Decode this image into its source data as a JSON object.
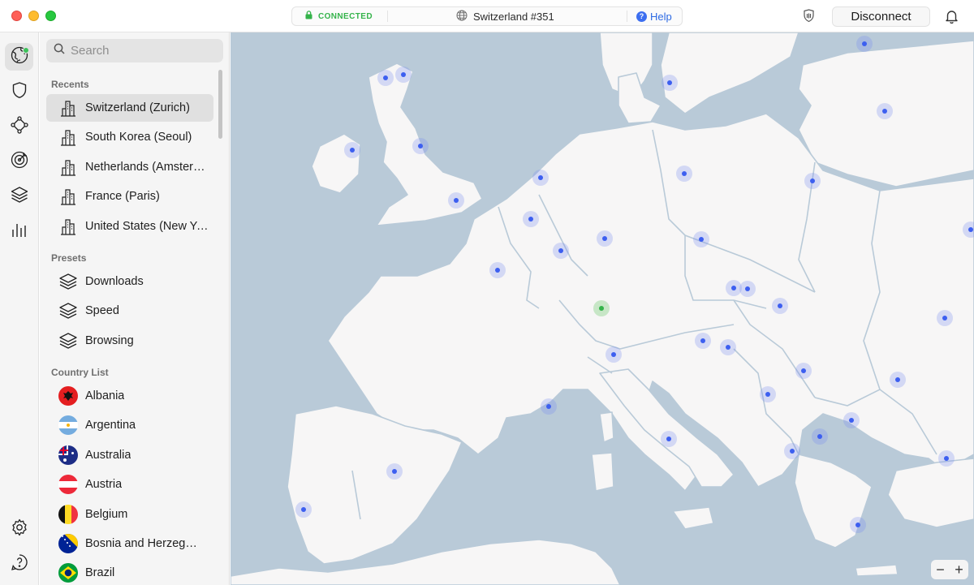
{
  "window": {
    "status_label": "CONNECTED",
    "server_name": "Switzerland #351",
    "help_label": "Help",
    "disconnect_label": "Disconnect"
  },
  "rail": {
    "items": [
      "globe-icon",
      "shield-icon",
      "meshnet-icon",
      "target-icon",
      "layers-icon",
      "stats-icon"
    ],
    "bottom": [
      "gear-icon",
      "help-icon"
    ]
  },
  "search": {
    "placeholder": "Search"
  },
  "recents": {
    "title": "Recents",
    "items": [
      {
        "label": "Switzerland (Zurich)",
        "selected": true
      },
      {
        "label": "South Korea (Seoul)"
      },
      {
        "label": "Netherlands (Amster…"
      },
      {
        "label": "France (Paris)"
      },
      {
        "label": "United States (New Yor…"
      }
    ]
  },
  "presets": {
    "title": "Presets",
    "items": [
      {
        "label": "Downloads"
      },
      {
        "label": "Speed"
      },
      {
        "label": "Browsing"
      }
    ]
  },
  "countries": {
    "title": "Country List",
    "items": [
      {
        "label": "Albania",
        "flag": "albania"
      },
      {
        "label": "Argentina",
        "flag": "argentina"
      },
      {
        "label": "Australia",
        "flag": "australia"
      },
      {
        "label": "Austria",
        "flag": "austria"
      },
      {
        "label": "Belgium",
        "flag": "belgium"
      },
      {
        "label": "Bosnia and Herzeg…",
        "flag": "bosnia"
      },
      {
        "label": "Brazil",
        "flag": "brazil"
      }
    ]
  },
  "colors": {
    "accent": "#3d5ff0",
    "connected": "#34b34a",
    "sea": "#b9cad8",
    "land": "#f7f6f6"
  },
  "map": {
    "zoom_out": "−",
    "zoom_in": "+"
  }
}
